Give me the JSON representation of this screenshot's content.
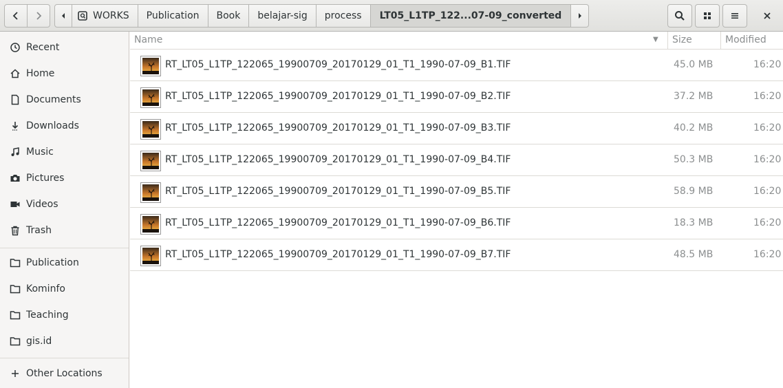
{
  "header": {
    "breadcrumbs": [
      "WORKS",
      "Publication",
      "Book",
      "belajar-sig",
      "process",
      "LT05_L1TP_122...07-09_converted"
    ]
  },
  "sidebar": {
    "places": [
      {
        "label": "Recent",
        "icon": "clock-icon"
      },
      {
        "label": "Home",
        "icon": "home-icon"
      },
      {
        "label": "Documents",
        "icon": "document-icon"
      },
      {
        "label": "Downloads",
        "icon": "download-icon"
      },
      {
        "label": "Music",
        "icon": "music-icon"
      },
      {
        "label": "Pictures",
        "icon": "camera-icon"
      },
      {
        "label": "Videos",
        "icon": "video-icon"
      },
      {
        "label": "Trash",
        "icon": "trash-icon"
      }
    ],
    "bookmarks": [
      {
        "label": "Publication",
        "icon": "folder-icon"
      },
      {
        "label": "Kominfo",
        "icon": "folder-icon"
      },
      {
        "label": "Teaching",
        "icon": "folder-icon"
      },
      {
        "label": "gis.id",
        "icon": "folder-icon"
      }
    ],
    "other": {
      "label": "Other Locations",
      "icon": "plus-icon"
    }
  },
  "columns": {
    "name": "Name",
    "size": "Size",
    "modified": "Modified"
  },
  "files": [
    {
      "name": "RT_LT05_L1TP_122065_19900709_20170129_01_T1_1990-07-09_B1.TIF",
      "size": "45.0 MB",
      "modified": "16:20"
    },
    {
      "name": "RT_LT05_L1TP_122065_19900709_20170129_01_T1_1990-07-09_B2.TIF",
      "size": "37.2 MB",
      "modified": "16:20"
    },
    {
      "name": "RT_LT05_L1TP_122065_19900709_20170129_01_T1_1990-07-09_B3.TIF",
      "size": "40.2 MB",
      "modified": "16:20"
    },
    {
      "name": "RT_LT05_L1TP_122065_19900709_20170129_01_T1_1990-07-09_B4.TIF",
      "size": "50.3 MB",
      "modified": "16:20"
    },
    {
      "name": "RT_LT05_L1TP_122065_19900709_20170129_01_T1_1990-07-09_B5.TIF",
      "size": "58.9 MB",
      "modified": "16:20"
    },
    {
      "name": "RT_LT05_L1TP_122065_19900709_20170129_01_T1_1990-07-09_B6.TIF",
      "size": "18.3 MB",
      "modified": "16:20"
    },
    {
      "name": "RT_LT05_L1TP_122065_19900709_20170129_01_T1_1990-07-09_B7.TIF",
      "size": "48.5 MB",
      "modified": "16:20"
    }
  ]
}
